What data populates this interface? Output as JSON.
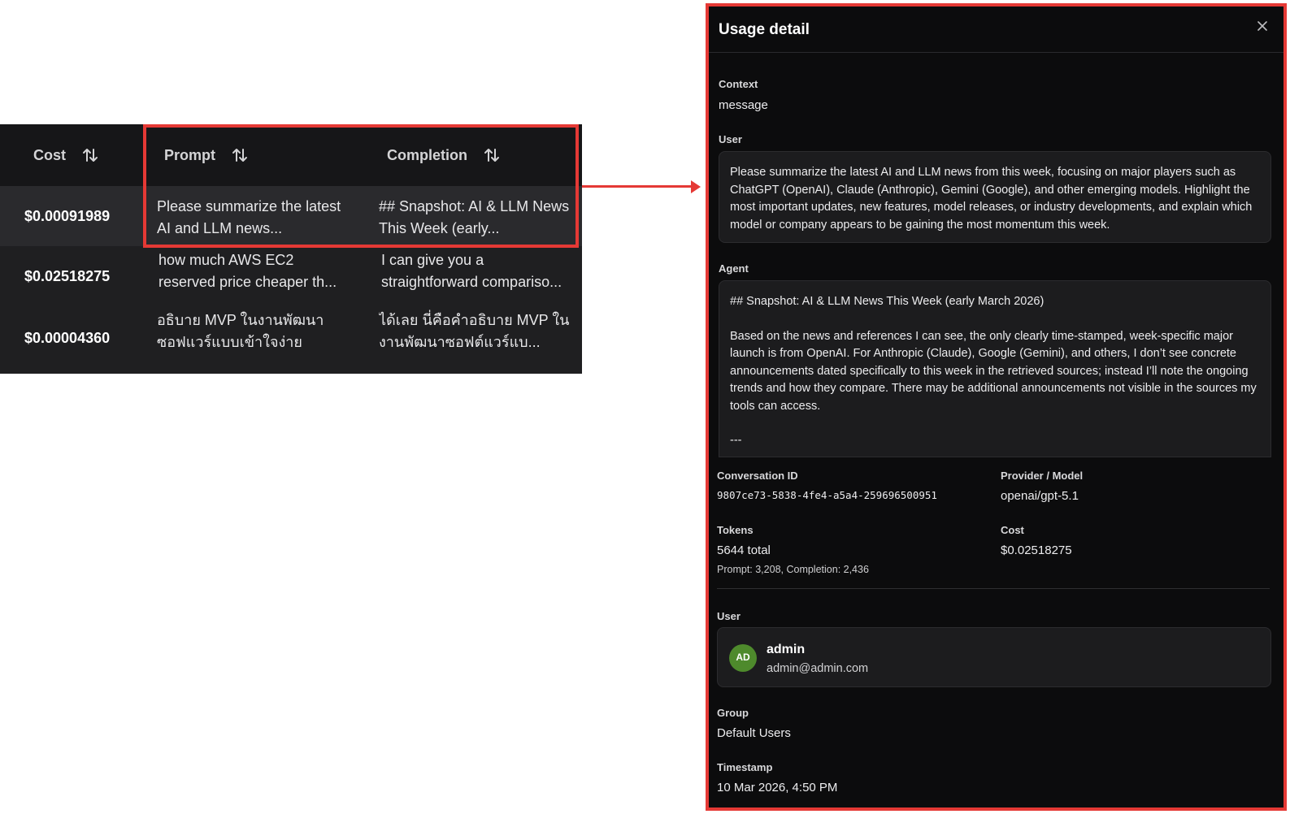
{
  "table": {
    "headers": {
      "cost": "Cost",
      "prompt": "Prompt",
      "completion": "Completion"
    },
    "rows": [
      {
        "cost": "$0.00091989",
        "prompt": "Please summarize the latest AI and LLM news...",
        "completion": "## Snapshot: AI & LLM News This Week (early..."
      },
      {
        "cost": "$0.02518275",
        "prompt": "how much AWS EC2 reserved price cheaper th...",
        "completion": "I can give you a straightforward compariso..."
      },
      {
        "cost": "$0.00004360",
        "prompt": "อธิบาย MVP ในงานพัฒนาซอฟแวร์แบบเข้าใจง่าย",
        "completion": "ได้เลย นี่คือคำอธิบาย MVP ในงานพัฒนาซอฟต์แวร์แบ..."
      }
    ]
  },
  "panel": {
    "title": "Usage detail",
    "context_label": "Context",
    "context_value": "message",
    "user_label": "User",
    "user_message": "Please summarize the latest AI and LLM news from this week, focusing on major players such as ChatGPT (OpenAI), Claude (Anthropic), Gemini (Google), and other emerging models. Highlight the most important updates, new features, model releases, or industry developments, and explain which model or company appears to be gaining the most momentum this week.",
    "agent_label": "Agent",
    "agent_p1": "## Snapshot: AI & LLM News This Week (early March 2026)",
    "agent_p2": "Based on the news and references I can see, the only clearly time-stamped, week-specific major launch is from OpenAI. For Anthropic (Claude), Google (Gemini), and others, I don’t see concrete announcements dated specifically to this week in the retrieved sources; instead I’ll note the ongoing trends and how they compare. There may be additional announcements not visible in the sources my tools can access.",
    "agent_p3": "---",
    "conversation_id_label": "Conversation ID",
    "conversation_id": "9807ce73-5838-4fe4-a5a4-259696500951",
    "provider_label": "Provider / Model",
    "provider_model": "openai/gpt-5.1",
    "tokens_label": "Tokens",
    "tokens_total": "5644 total",
    "tokens_breakdown": "Prompt: 3,208, Completion: 2,436",
    "cost_label": "Cost",
    "cost_value": "$0.02518275",
    "user_section_label": "User",
    "user_initials": "AD",
    "user_name": "admin",
    "user_email": "admin@admin.com",
    "group_label": "Group",
    "group_value": "Default Users",
    "timestamp_label": "Timestamp",
    "timestamp_value": "10 Mar 2026, 4:50 PM"
  },
  "colors": {
    "highlight": "#e53935",
    "avatar": "#4e8a2c",
    "panel_bg": "#0c0c0d",
    "table_bg": "#1f1f21"
  },
  "icons": {
    "sort": "sort-arrows-icon",
    "close": "close-icon"
  }
}
